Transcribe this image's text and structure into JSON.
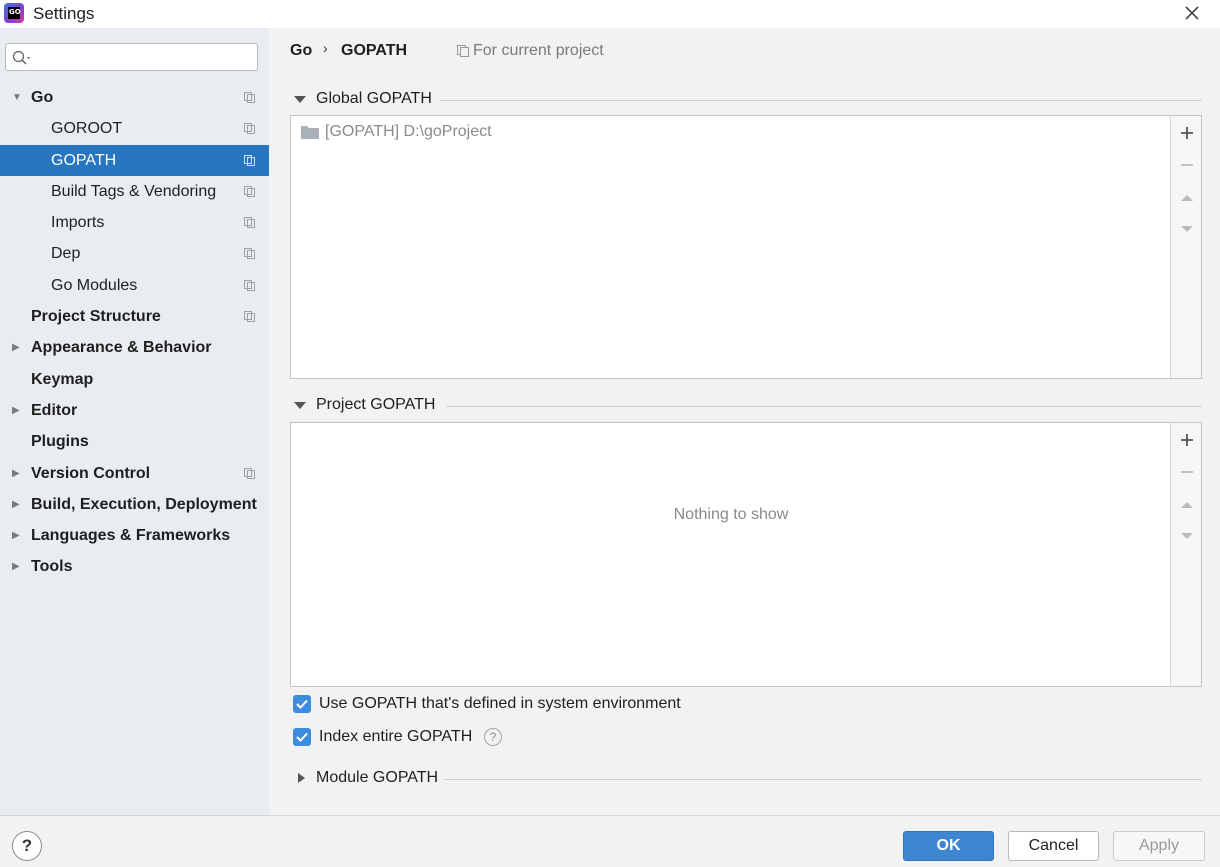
{
  "window": {
    "title": "Settings",
    "app_icon_text": "GO"
  },
  "search": {
    "placeholder": ""
  },
  "sidebar": {
    "items": [
      {
        "label": "Go",
        "bold": true,
        "level": 0,
        "arrow": "down",
        "copy": true
      },
      {
        "label": "GOROOT",
        "bold": false,
        "level": 1,
        "arrow": "",
        "copy": true
      },
      {
        "label": "GOPATH",
        "bold": false,
        "level": 1,
        "arrow": "",
        "copy": true,
        "selected": true
      },
      {
        "label": "Build Tags & Vendoring",
        "bold": false,
        "level": 1,
        "arrow": "",
        "copy": true
      },
      {
        "label": "Imports",
        "bold": false,
        "level": 1,
        "arrow": "",
        "copy": true
      },
      {
        "label": "Dep",
        "bold": false,
        "level": 1,
        "arrow": "",
        "copy": true
      },
      {
        "label": "Go Modules",
        "bold": false,
        "level": 1,
        "arrow": "",
        "copy": true
      },
      {
        "label": "Project Structure",
        "bold": true,
        "level": 0,
        "arrow": "",
        "copy": true
      },
      {
        "label": "Appearance & Behavior",
        "bold": true,
        "level": 0,
        "arrow": "right",
        "copy": false
      },
      {
        "label": "Keymap",
        "bold": true,
        "level": 0,
        "arrow": "",
        "copy": false
      },
      {
        "label": "Editor",
        "bold": true,
        "level": 0,
        "arrow": "right",
        "copy": false
      },
      {
        "label": "Plugins",
        "bold": true,
        "level": 0,
        "arrow": "",
        "copy": false
      },
      {
        "label": "Version Control",
        "bold": true,
        "level": 0,
        "arrow": "right",
        "copy": true
      },
      {
        "label": "Build, Execution, Deployment",
        "bold": true,
        "level": 0,
        "arrow": "right",
        "copy": false
      },
      {
        "label": "Languages & Frameworks",
        "bold": true,
        "level": 0,
        "arrow": "right",
        "copy": false
      },
      {
        "label": "Tools",
        "bold": true,
        "level": 0,
        "arrow": "right",
        "copy": false
      }
    ]
  },
  "breadcrumb": {
    "parent": "Go",
    "separator": "›",
    "current": "GOPATH",
    "scope": "For current project"
  },
  "global_gopath": {
    "header": "Global GOPATH",
    "entries": [
      "[GOPATH] D:\\goProject"
    ]
  },
  "project_gopath": {
    "header": "Project GOPATH",
    "empty_text": "Nothing to show"
  },
  "options": {
    "use_system_gopath": {
      "label": "Use GOPATH that's defined in system environment",
      "checked": true
    },
    "index_entire_gopath": {
      "label": "Index entire GOPATH",
      "checked": true
    },
    "help_glyph": "?"
  },
  "module_gopath": {
    "header": "Module GOPATH"
  },
  "footer": {
    "help_glyph": "?",
    "ok": "OK",
    "cancel": "Cancel",
    "apply": "Apply"
  },
  "colors": {
    "selection": "#2675bf",
    "checkbox": "#3c8ce0",
    "ok_button": "#3f86d1",
    "sidebar_bg": "#e9edf2"
  }
}
